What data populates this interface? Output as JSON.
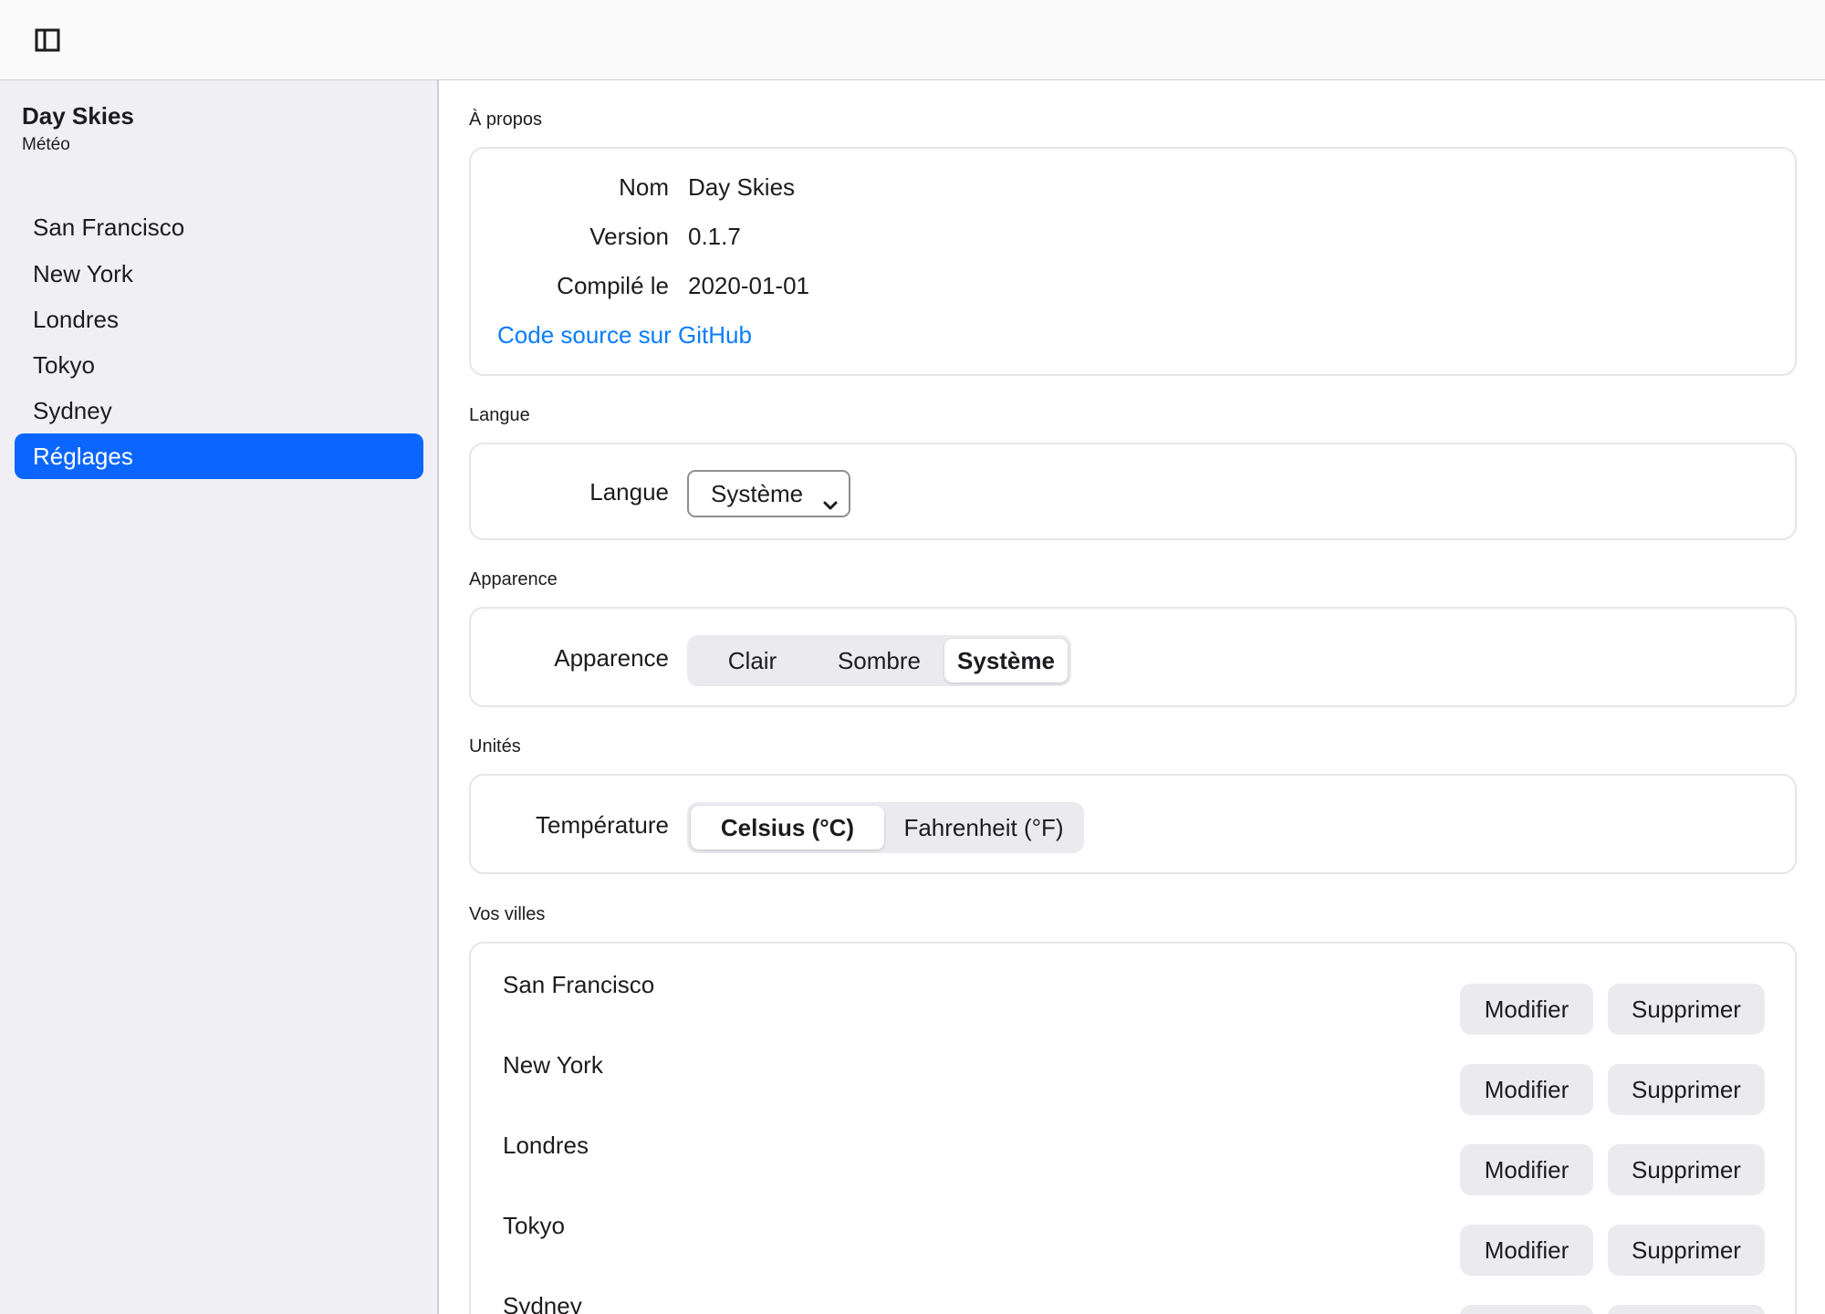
{
  "toolbar": {
    "toggle_icon": "sidebar-toggle-icon"
  },
  "sidebar": {
    "app_title": "Day Skies",
    "app_subtitle": "Météo",
    "items": [
      {
        "label": "San Francisco",
        "active": false
      },
      {
        "label": "New York",
        "active": false
      },
      {
        "label": "Londres",
        "active": false
      },
      {
        "label": "Tokyo",
        "active": false
      },
      {
        "label": "Sydney",
        "active": false
      },
      {
        "label": "Réglages",
        "active": true
      }
    ]
  },
  "about": {
    "section_title": "À propos",
    "name_label": "Nom",
    "name_value": "Day Skies",
    "version_label": "Version",
    "version_value": "0.1.7",
    "built_label": "Compilé le",
    "built_value": "2020-01-01",
    "source_link": "Code source sur GitHub"
  },
  "language": {
    "section_title": "Langue",
    "label": "Langue",
    "selected": "Système"
  },
  "appearance": {
    "section_title": "Apparence",
    "label": "Apparence",
    "options": [
      "Clair",
      "Sombre",
      "Système"
    ],
    "selected": "Système"
  },
  "units": {
    "section_title": "Unités",
    "label": "Température",
    "options": [
      "Celsius (°C)",
      "Fahrenheit (°F)"
    ],
    "selected": "Celsius (°C)"
  },
  "cities": {
    "section_title": "Vos villes",
    "edit_label": "Modifier",
    "delete_label": "Supprimer",
    "items": [
      "San Francisco",
      "New York",
      "Londres",
      "Tokyo",
      "Sydney"
    ]
  },
  "colors": {
    "accent": "#0a66ff",
    "link": "#0a7cff",
    "sidebar_bg": "#f0f0f4",
    "button_bg": "#ebebef"
  }
}
